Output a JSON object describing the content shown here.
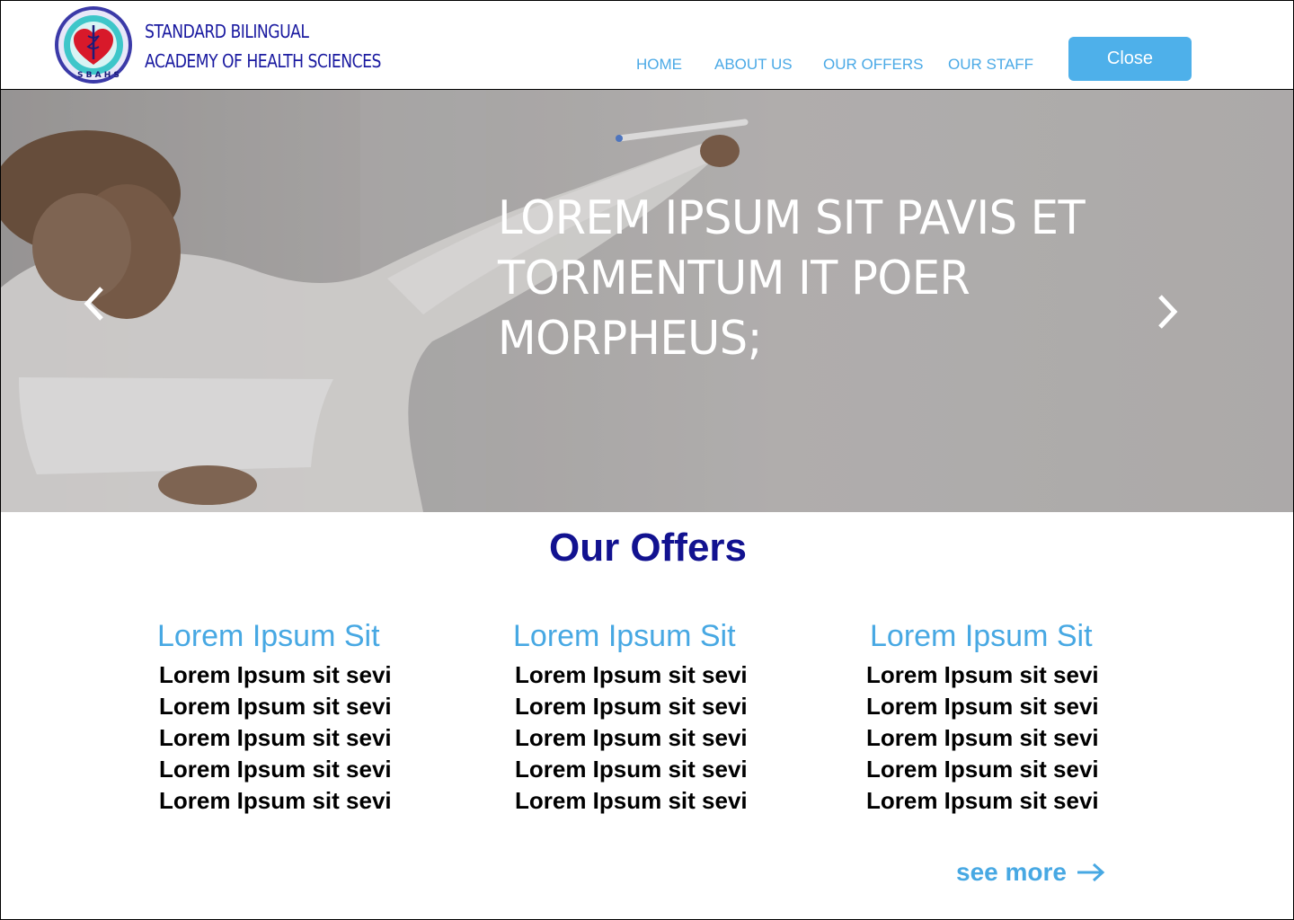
{
  "brand": {
    "line1": "STANDARD BILINGUAL",
    "line2": "ACADEMY OF HEALTH SCIENCES",
    "logo_icon": "school-seal-heart-caduceus-logo",
    "logo_text": "S B A H S"
  },
  "nav": {
    "items": [
      {
        "label": "HOME"
      },
      {
        "label": "ABOUT US"
      },
      {
        "label": "OUR OFFERS"
      },
      {
        "label": "OUR STAFF"
      }
    ],
    "close_label": "Close"
  },
  "hero": {
    "lines": [
      "LOREM IPSUM SIT PAVIS ET",
      "TORMENTUM IT POER",
      "MORPHEUS;"
    ],
    "prev_icon": "chevron-left-icon",
    "next_icon": "chevron-right-icon"
  },
  "offers": {
    "title": "Our Offers",
    "columns": [
      {
        "heading": "Lorem Ipsum Sit",
        "items": [
          "Lorem Ipsum sit sevi",
          "Lorem Ipsum sit sevi",
          "Lorem Ipsum sit sevi",
          "Lorem Ipsum sit sevi",
          "Lorem Ipsum sit sevi"
        ]
      },
      {
        "heading": "Lorem Ipsum Sit",
        "items": [
          "Lorem Ipsum sit sevi",
          "Lorem Ipsum sit sevi",
          "Lorem Ipsum sit sevi",
          "Lorem Ipsum sit sevi",
          "Lorem Ipsum sit sevi"
        ]
      },
      {
        "heading": "Lorem Ipsum Sit",
        "items": [
          "Lorem Ipsum sit sevi",
          "Lorem Ipsum sit sevi",
          "Lorem Ipsum sit sevi",
          "Lorem Ipsum sit sevi",
          "Lorem Ipsum sit sevi"
        ]
      }
    ],
    "see_more": "see more"
  },
  "colors": {
    "brand_navy": "#1a1aa0",
    "accent_blue": "#4eb0ea",
    "heading_blue": "#47a8e3",
    "title_navy": "#121290"
  }
}
